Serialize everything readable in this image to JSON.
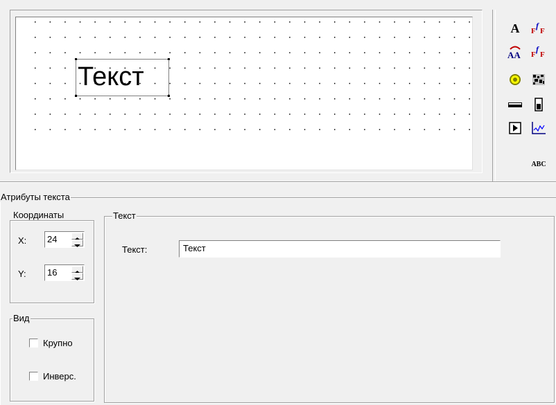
{
  "canvas": {
    "element_text": "Текст"
  },
  "toolbox": {
    "tools": [
      {
        "name": "text-tool-icon",
        "glyph": "A"
      },
      {
        "name": "formula-tool-icon",
        "glyph": "ғᶠғ"
      },
      {
        "name": "auto-text-tool-icon",
        "glyph": "ÂÂ"
      },
      {
        "name": "formula-auto-tool-icon",
        "glyph": "ғᶠғ"
      },
      {
        "name": "indicator-tool-icon",
        "glyph": "◉"
      },
      {
        "name": "bitmap-tool-icon",
        "glyph": "▦"
      },
      {
        "name": "bar-tool-icon",
        "glyph": "▭"
      },
      {
        "name": "level-tool-icon",
        "glyph": "▮"
      },
      {
        "name": "button-tool-icon",
        "glyph": "▶"
      },
      {
        "name": "chart-tool-icon",
        "glyph": "〰"
      },
      {
        "name": "abc-tool-icon",
        "glyph": "ABC"
      }
    ]
  },
  "attributes": {
    "title": "Атрибуты текста",
    "coords": {
      "title": "Координаты",
      "x_label": "X:",
      "x_value": "24",
      "y_label": "Y:",
      "y_value": "16"
    },
    "view": {
      "title": "Вид",
      "large_label": "Крупно",
      "invert_label": "Инверс."
    },
    "text": {
      "title": "Текст",
      "field_label": "Текст:",
      "field_value": "Текст"
    }
  }
}
